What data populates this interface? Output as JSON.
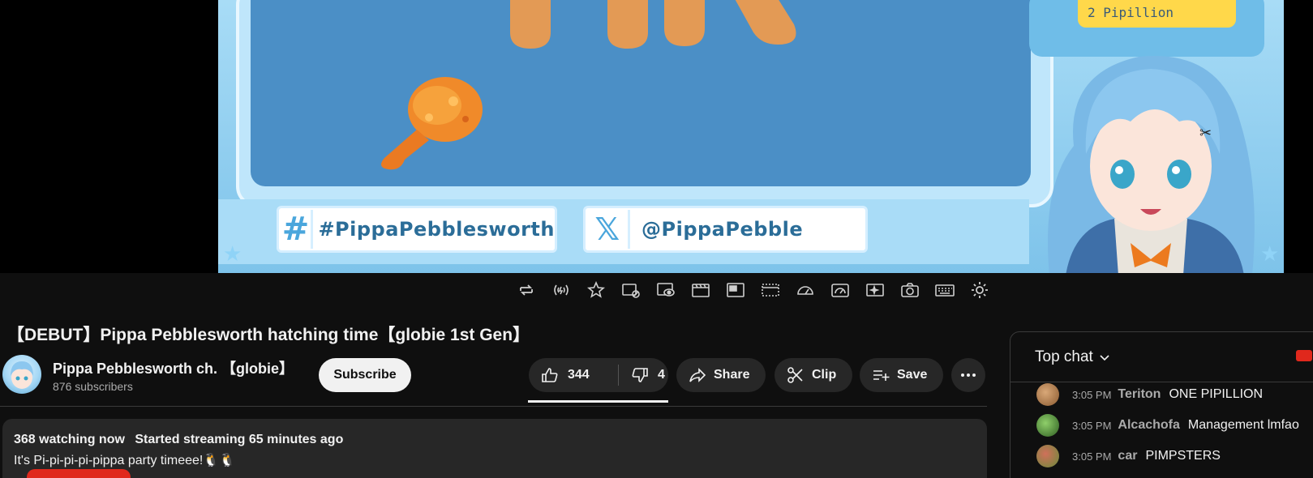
{
  "overlay": {
    "hashtag": "#PippaPebblesworth",
    "x_handle": "@PippaPebble",
    "milestone_text": "2 Pipillion"
  },
  "player_controls": [
    "loop-icon",
    "radio-signal-icon",
    "star-icon",
    "ads-blocked-icon",
    "preview-icon",
    "film-icon",
    "picture-in-picture-icon",
    "dotted-frame-icon",
    "speed-icon",
    "speed-dial-icon",
    "sparkle-icon",
    "camera-icon",
    "keyboard-icon",
    "settings-gear-icon"
  ],
  "video": {
    "title": "【DEBUT】Pippa Pebblesworth hatching time【globie 1st Gen】"
  },
  "channel": {
    "name": "Pippa Pebblesworth ch. 【globie】",
    "subscribers": "876 subscribers",
    "subscribe_label": "Subscribe"
  },
  "actions": {
    "likes": "344",
    "dislikes": "4",
    "share_label": "Share",
    "clip_label": "Clip",
    "save_label": "Save"
  },
  "description": {
    "watching": "368 watching now",
    "started": "Started streaming 65 minutes ago",
    "text": "It's Pi-pi-pi-pi-pippa party timeee!🐧🐧"
  },
  "chat": {
    "title": "Top chat",
    "messages": [
      {
        "time": "3:05 PM",
        "author": "Teriton",
        "text": "ONE PIPILLION",
        "avatar_color": "#b07a4a"
      },
      {
        "time": "3:05 PM",
        "author": "Alcachofa",
        "text": "Management lmfao",
        "avatar_color": "#4f8a3a"
      },
      {
        "time": "3:05 PM",
        "author": "car",
        "text": "PIMPSTERS",
        "avatar_color": "#a8473a"
      }
    ]
  },
  "colors": {
    "background": "#0f0f0f",
    "pill": "#272727",
    "accent_red": "#e0281c",
    "overlay_blue": "#4b8fc6"
  }
}
